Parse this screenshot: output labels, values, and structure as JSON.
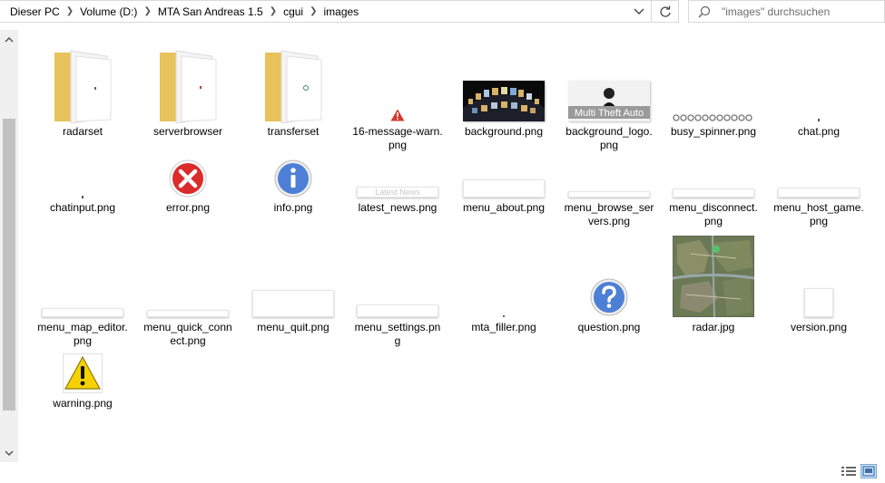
{
  "breadcrumb": [
    "Dieser PC",
    "Volume (D:)",
    "MTA San Andreas 1.5",
    "cgui",
    "images"
  ],
  "search": {
    "placeholder": "\"images\" durchsuchen"
  },
  "items": [
    {
      "label": "radarset",
      "type": "folder"
    },
    {
      "label": "serverbrowser",
      "type": "folder"
    },
    {
      "label": "transferset",
      "type": "folder"
    },
    {
      "label": "16-message-warn.png",
      "type": "warn-small"
    },
    {
      "label": "background.png",
      "type": "background"
    },
    {
      "label": "background_logo.png",
      "type": "bglogo",
      "logo_text": "Multi Theft Auto"
    },
    {
      "label": "busy_spinner.png",
      "type": "spinner"
    },
    {
      "label": "chat.png",
      "type": "dot"
    },
    {
      "label": "chatinput.png",
      "type": "dot"
    },
    {
      "label": "error.png",
      "type": "error"
    },
    {
      "label": "info.png",
      "type": "info"
    },
    {
      "label": "latest_news.png",
      "type": "strip",
      "faint_text": "Latest News"
    },
    {
      "label": "menu_about.png",
      "type": "strip"
    },
    {
      "label": "menu_browse_servers.png",
      "type": "strip-thin"
    },
    {
      "label": "menu_disconnect.png",
      "type": "strip-thin"
    },
    {
      "label": "menu_host_game.png",
      "type": "strip-thin"
    },
    {
      "label": "menu_map_editor.png",
      "type": "strip-thin"
    },
    {
      "label": "menu_quick_connect.png",
      "type": "strip-thin"
    },
    {
      "label": "menu_quit.png",
      "type": "strip-quit"
    },
    {
      "label": "menu_settings.png",
      "type": "strip"
    },
    {
      "label": "mta_filler.png",
      "type": "dot"
    },
    {
      "label": "question.png",
      "type": "question"
    },
    {
      "label": "radar.jpg",
      "type": "radar"
    },
    {
      "label": "version.png",
      "type": "version"
    },
    {
      "label": "warning.png",
      "type": "warning"
    }
  ]
}
